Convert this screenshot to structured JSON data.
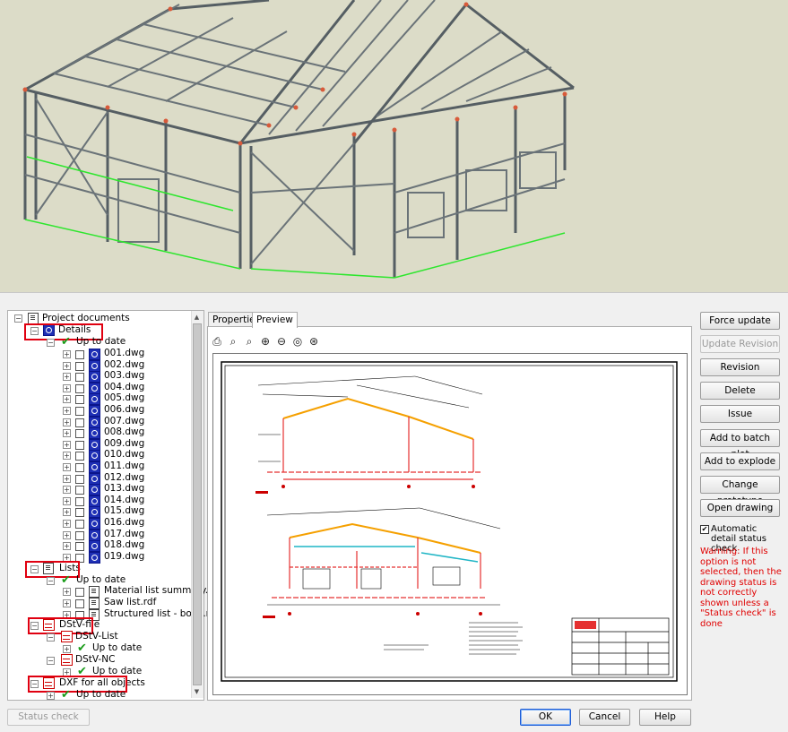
{
  "tree": {
    "root": "Project documents",
    "details": {
      "label": "Details",
      "status": "Up to date",
      "files": [
        "001.dwg",
        "002.dwg",
        "003.dwg",
        "004.dwg",
        "005.dwg",
        "006.dwg",
        "007.dwg",
        "008.dwg",
        "009.dwg",
        "010.dwg",
        "011.dwg",
        "012.dwg",
        "013.dwg",
        "014.dwg",
        "015.dwg",
        "016.dwg",
        "017.dwg",
        "018.dwg",
        "019.dwg"
      ]
    },
    "lists": {
      "label": "Lists",
      "status": "Up to date",
      "files": [
        "Material list summary.rdf",
        "Saw list.rdf",
        "Structured list - bolts.rdf"
      ]
    },
    "dstv": {
      "label": "DStV-file",
      "list_label": "DStV-List",
      "list_status": "Up to date",
      "nc_label": "DStV-NC",
      "nc_status": "Up to date"
    },
    "dxf": {
      "label": "DXF for all objects",
      "status": "Up to date"
    }
  },
  "tabs": [
    "Properties",
    "Preview"
  ],
  "active_tab": "Preview",
  "toolbar_icons": [
    "print-icon",
    "zoom-window-icon",
    "zoom-realtime-icon",
    "zoom-in-icon",
    "zoom-out-icon",
    "zoom-previous-icon",
    "zoom-extents-icon"
  ],
  "buttons": {
    "force_update": "Force update",
    "update_revision": "Update Revision",
    "revision": "Revision",
    "delete": "Delete",
    "issue": "Issue",
    "batch_plot": "Add to batch plot",
    "explode": "Add to explode",
    "prototype": "Change prototype",
    "open_drawing": "Open drawing"
  },
  "auto_check": {
    "label": "Automatic detail status check",
    "checked": true
  },
  "warning": "Warning: If this option is not selected, then the drawing status is not correctly shown unless a \"Status check\" is done",
  "bottom": {
    "status_check": "Status check",
    "ok": "OK",
    "cancel": "Cancel",
    "help": "Help"
  },
  "colors": {
    "highlight": "#e00010",
    "warning": "#e00000",
    "viewport_bg": "#dcdcc8",
    "steel": "#6a7378"
  }
}
